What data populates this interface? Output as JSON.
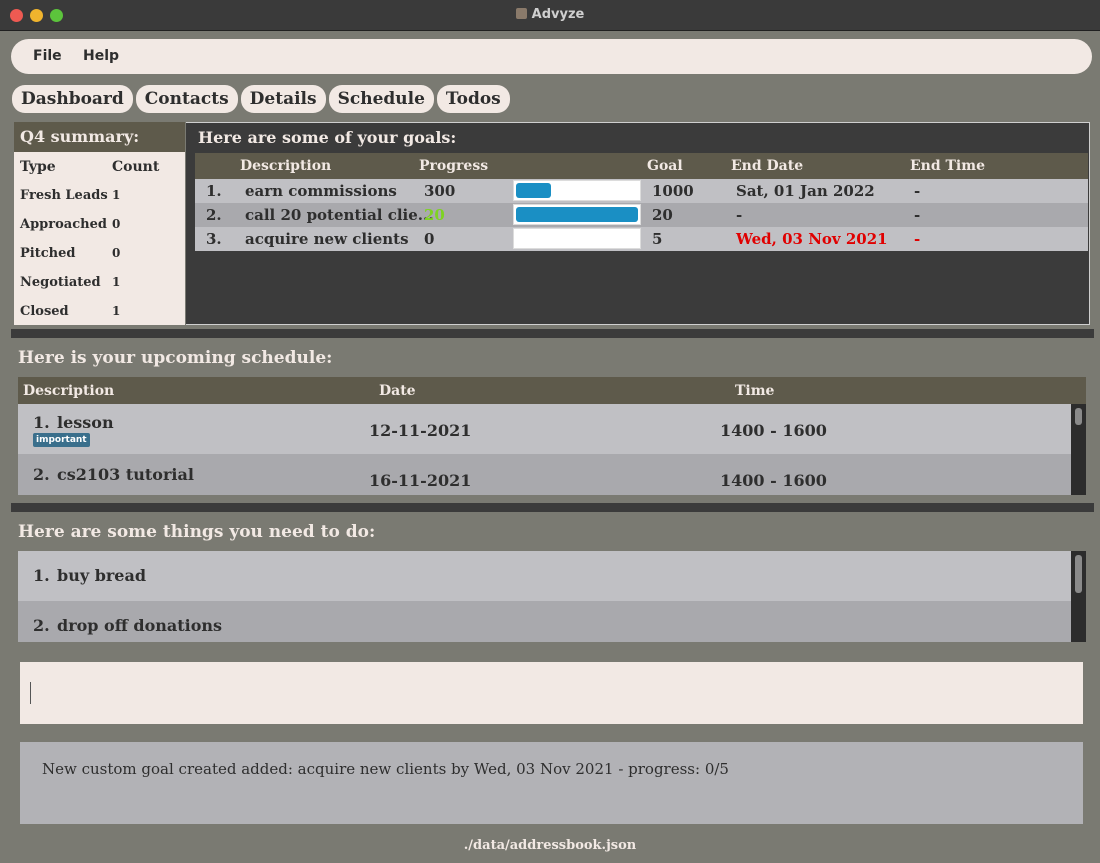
{
  "window": {
    "title": "Advyze"
  },
  "menu": {
    "file": "File",
    "help": "Help"
  },
  "tabs": [
    "Dashboard",
    "Contacts",
    "Details",
    "Schedule",
    "Todos"
  ],
  "summary": {
    "title": "Q4 summary:",
    "col_type": "Type",
    "col_count": "Count",
    "rows": [
      {
        "type": "Fresh Leads",
        "count": "1"
      },
      {
        "type": "Approached",
        "count": "0"
      },
      {
        "type": "Pitched",
        "count": "0"
      },
      {
        "type": "Negotiated",
        "count": "1"
      },
      {
        "type": "Closed",
        "count": "1"
      }
    ]
  },
  "goals": {
    "title": "Here are some of your goals:",
    "headers": {
      "description": "Description",
      "progress": "Progress",
      "goal": "Goal",
      "end_date": "End Date",
      "end_time": "End Time"
    },
    "rows": [
      {
        "index": "1.",
        "description": "earn commissions",
        "progress": "300",
        "goal": "1000",
        "fraction": 0.3,
        "end_date": "Sat, 01 Jan 2022",
        "end_time": "-",
        "status": "normal"
      },
      {
        "index": "2.",
        "description": "call 20 potential clie...",
        "progress": "20",
        "goal": "20",
        "fraction": 1.0,
        "end_date": "-",
        "end_time": "-",
        "status": "complete"
      },
      {
        "index": "3.",
        "description": "acquire new clients",
        "progress": "0",
        "goal": "5",
        "fraction": 0.0,
        "end_date": "Wed, 03 Nov 2021",
        "end_time": "-",
        "status": "overdue"
      }
    ],
    "colors": {
      "complete": "#7ed321",
      "overdue": "#e00000",
      "normal": "#2e2e2e"
    }
  },
  "schedule": {
    "title": "Here is your upcoming schedule:",
    "headers": {
      "description": "Description",
      "date": "Date",
      "time": "Time"
    },
    "items": [
      {
        "index": "1.",
        "description": "lesson",
        "tag": "important",
        "date": "12-11-2021",
        "time": "1400 - 1600"
      },
      {
        "index": "2.",
        "description": "cs2103 tutorial",
        "tag": "",
        "date": "16-11-2021",
        "time": "1400 - 1600"
      }
    ]
  },
  "todos": {
    "title": "Here are some things you need to do:",
    "items": [
      {
        "index": "1.",
        "description": "buy bread"
      },
      {
        "index": "2.",
        "description": "drop off donations"
      }
    ]
  },
  "command": {
    "value": ""
  },
  "result": {
    "message": "New custom goal created added: acquire new clients by Wed, 03 Nov 2021 - progress: 0/5"
  },
  "status_bar": {
    "path": "./data/addressbook.json"
  },
  "colors": {
    "panel_light": "#f2e9e4",
    "header_bar": "#5e5a4b",
    "progress": "#1a8fc4",
    "row_light": "#c0c0c4",
    "row_dark": "#a9a9ad"
  }
}
